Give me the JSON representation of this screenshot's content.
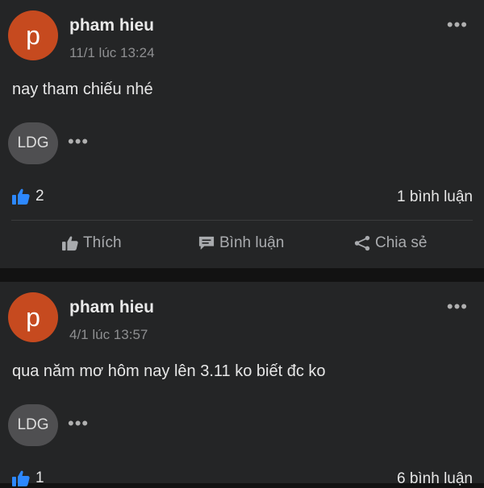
{
  "posts": [
    {
      "avatar_letter": "p",
      "author": "pham hieu",
      "time": "11/1 lúc 13:24",
      "more": "•••",
      "text": "nay tham chiếu nhé",
      "tagged": {
        "label": "LDG",
        "more": "•••"
      },
      "likes": "2",
      "comments": "1 bình luận",
      "actions": {
        "like": "Thích",
        "comment": "Bình luận",
        "share": "Chia sẻ"
      }
    },
    {
      "avatar_letter": "p",
      "author": "pham hieu",
      "time": "4/1 lúc 13:57",
      "more": "•••",
      "text": "qua năm mơ hôm nay lên 3.11 ko biết đc ko",
      "tagged": {
        "label": "LDG",
        "more": "•••"
      },
      "likes": "1",
      "comments": "6 bình luận"
    }
  ],
  "colors": {
    "background": "#121212",
    "card": "#242526",
    "avatar": "#c64a1f",
    "like_blue": "#2d88ff",
    "muted_text": "#8e8f91"
  }
}
